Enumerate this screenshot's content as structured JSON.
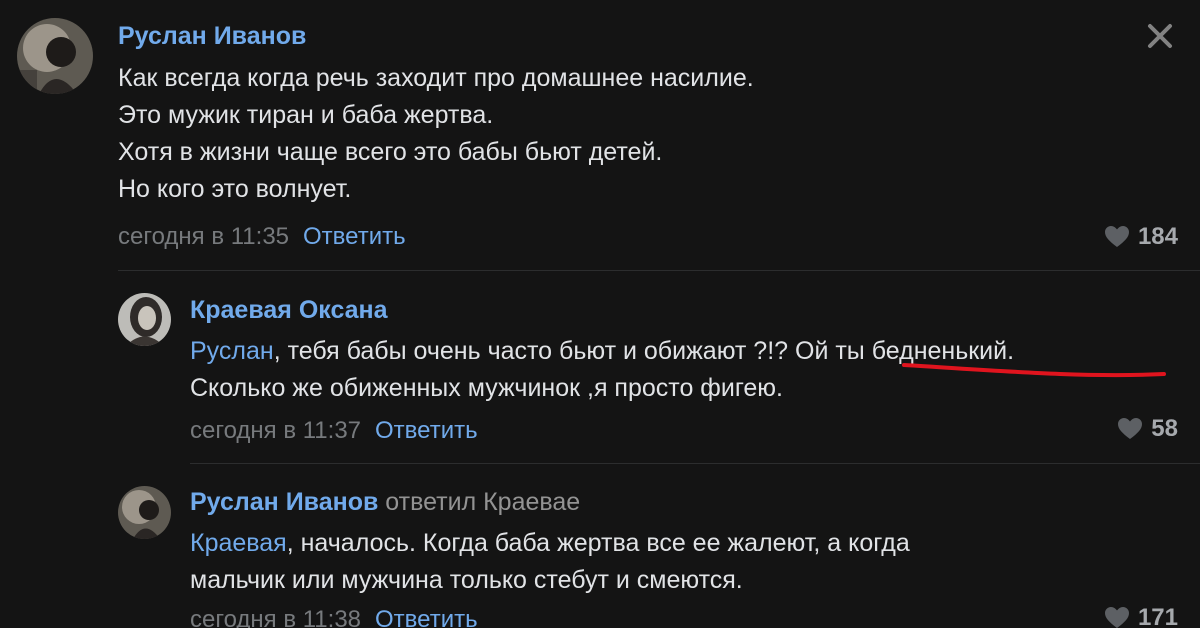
{
  "comments": [
    {
      "author": "Руслан Иванов",
      "lines": [
        "Как всегда когда речь заходит про домашнее насилие.",
        "Это мужик тиран и баба жертва.",
        "Хотя в жизни чаще всего это бабы бьют детей.",
        "Но кого это волнует."
      ],
      "time": "сегодня в 11:35",
      "reply_label": "Ответить",
      "likes": "184"
    },
    {
      "author": "Краевая Оксана",
      "mention": "Руслан",
      "line1_rest": ", тебя бабы очень часто бьют и обижают ?!? Ой ты бедненький.",
      "line2": "Сколько же обиженных мужчинок ,я просто фигею.",
      "time": "сегодня в 11:37",
      "reply_label": "Ответить",
      "likes": "58"
    },
    {
      "author": "Руслан Иванов",
      "replied_to": "ответил Краевае",
      "mention": "Краевая",
      "line1_rest": ", началось. Когда баба жертва все ее жалеют, а когда",
      "line2": "мальчик или мужчина только стебут и смеются.",
      "time": "сегодня в 11:38",
      "reply_label": "Ответить",
      "likes": "171"
    }
  ],
  "colors": {
    "background": "#141414",
    "link": "#71aaeb",
    "text": "#e1e3e6",
    "meta": "#777a7d",
    "annotation": "#e0141e"
  },
  "icons": {
    "close": "close-icon",
    "like": "heart-icon"
  }
}
